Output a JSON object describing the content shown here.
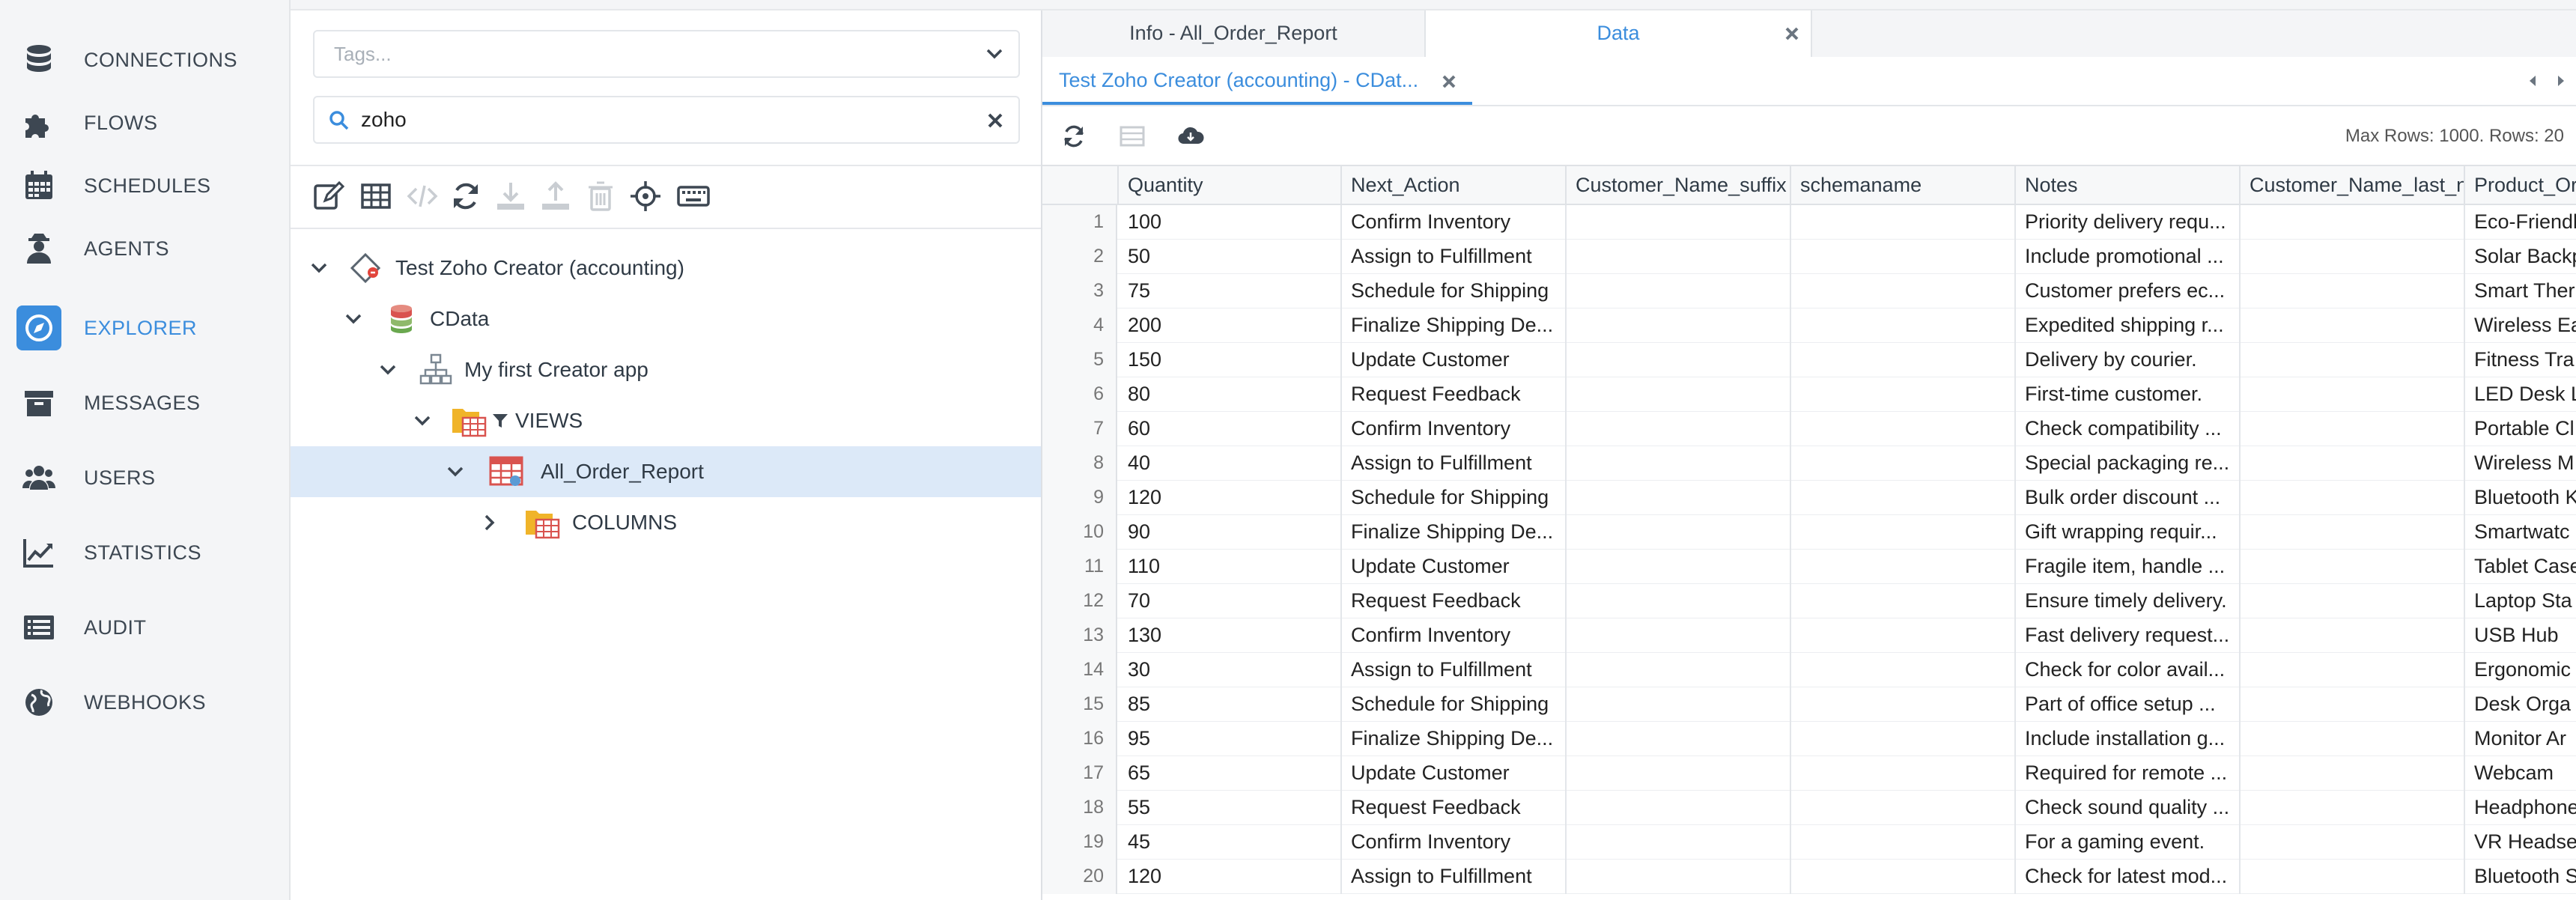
{
  "nav": {
    "items": [
      {
        "label": "CONNECTIONS",
        "icon": "database-icon"
      },
      {
        "label": "FLOWS",
        "icon": "puzzle-icon"
      },
      {
        "label": "SCHEDULES",
        "icon": "calendar-icon"
      },
      {
        "label": "AGENTS",
        "icon": "agent-icon"
      },
      {
        "label": "EXPLORER",
        "icon": "compass-icon",
        "active": true
      },
      {
        "label": "MESSAGES",
        "icon": "archive-icon"
      },
      {
        "label": "USERS",
        "icon": "users-icon"
      },
      {
        "label": "STATISTICS",
        "icon": "chart-line-icon"
      },
      {
        "label": "AUDIT",
        "icon": "list-icon"
      },
      {
        "label": "WEBHOOKS",
        "icon": "globe-icon"
      }
    ],
    "accent": "#3b8ddd"
  },
  "tree_panel": {
    "tags_placeholder": "Tags...",
    "search_value": "zoho",
    "nodes": [
      {
        "label": "Test Zoho Creator (accounting)"
      },
      {
        "label": "CData"
      },
      {
        "label": "My first Creator app"
      },
      {
        "label": "VIEWS"
      },
      {
        "label": "All_Order_Report",
        "selected": true
      },
      {
        "label": "COLUMNS"
      }
    ]
  },
  "data_panel": {
    "tabs": [
      {
        "label": "Info - All_Order_Report"
      },
      {
        "label": "Data",
        "active": true
      }
    ],
    "subtab_label": "Test Zoho Creator (accounting) - CDat...",
    "max_rows_text": "Max Rows: 1000. Rows: 20",
    "columns": [
      "Quantity",
      "Next_Action",
      "Customer_Name_suffix",
      "schemaname",
      "Notes",
      "Customer_Name_last_n",
      "Product_Or"
    ],
    "rows": [
      [
        "1",
        "100",
        "Confirm Inventory",
        "",
        "",
        "Priority delivery requ...",
        "",
        "Eco-Friendl"
      ],
      [
        "2",
        "50",
        "Assign to Fulfillment",
        "",
        "",
        "Include promotional ...",
        "",
        "Solar Backp"
      ],
      [
        "3",
        "75",
        "Schedule for Shipping",
        "",
        "",
        "Customer prefers ec...",
        "",
        "Smart Ther"
      ],
      [
        "4",
        "200",
        "Finalize Shipping De...",
        "",
        "",
        "Expedited shipping r...",
        "",
        "Wireless Ea"
      ],
      [
        "5",
        "150",
        "Update Customer",
        "",
        "",
        "Delivery by courier.",
        "",
        "Fitness Tra"
      ],
      [
        "6",
        "80",
        "Request Feedback",
        "",
        "",
        "First-time customer.",
        "",
        "LED Desk L"
      ],
      [
        "7",
        "60",
        "Confirm Inventory",
        "",
        "",
        "Check compatibility ...",
        "",
        "Portable Cl"
      ],
      [
        "8",
        "40",
        "Assign to Fulfillment",
        "",
        "",
        "Special packaging re...",
        "",
        "Wireless M"
      ],
      [
        "9",
        "120",
        "Schedule for Shipping",
        "",
        "",
        "Bulk order discount ...",
        "",
        "Bluetooth K"
      ],
      [
        "10",
        "90",
        "Finalize Shipping De...",
        "",
        "",
        "Gift wrapping requir...",
        "",
        "Smartwatc"
      ],
      [
        "11",
        "110",
        "Update Customer",
        "",
        "",
        "Fragile item, handle ...",
        "",
        "Tablet Case"
      ],
      [
        "12",
        "70",
        "Request Feedback",
        "",
        "",
        "Ensure timely delivery.",
        "",
        "Laptop Sta"
      ],
      [
        "13",
        "130",
        "Confirm Inventory",
        "",
        "",
        "Fast delivery request...",
        "",
        "USB Hub"
      ],
      [
        "14",
        "30",
        "Assign to Fulfillment",
        "",
        "",
        "Check for color avail...",
        "",
        "Ergonomic"
      ],
      [
        "15",
        "85",
        "Schedule for Shipping",
        "",
        "",
        "Part of office setup ...",
        "",
        "Desk Orga"
      ],
      [
        "16",
        "95",
        "Finalize Shipping De...",
        "",
        "",
        "Include installation g...",
        "",
        "Monitor Ar"
      ],
      [
        "17",
        "65",
        "Update Customer",
        "",
        "",
        "Required for remote ...",
        "",
        "Webcam"
      ],
      [
        "18",
        "55",
        "Request Feedback",
        "",
        "",
        "Check sound quality ...",
        "",
        "Headphone"
      ],
      [
        "19",
        "45",
        "Confirm Inventory",
        "",
        "",
        "For a gaming event.",
        "",
        "VR Headse"
      ],
      [
        "20",
        "120",
        "Assign to Fulfillment",
        "",
        "",
        "Check for latest mod...",
        "",
        "Bluetooth S"
      ]
    ]
  }
}
